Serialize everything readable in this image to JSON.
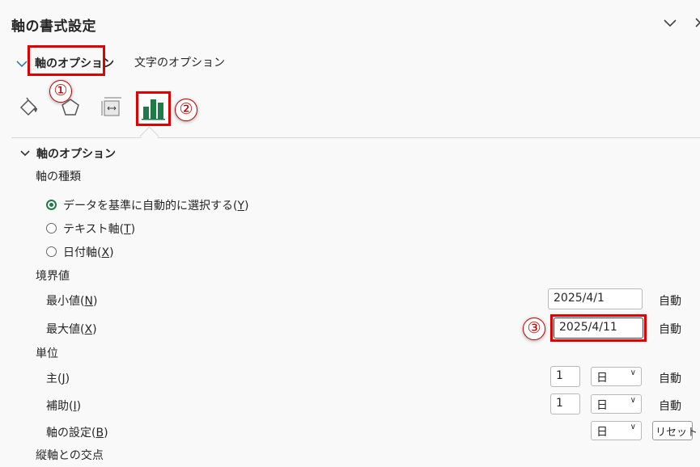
{
  "header": {
    "title": "軸の書式設定",
    "collapse_icon": "chevron-down-icon",
    "close_icon": "close-icon"
  },
  "tabs": {
    "axis_options": "軸のオプション",
    "text_options": "文字のオプション"
  },
  "icons": [
    "fill-line-icon",
    "effects-pentagon-icon",
    "size-properties-icon",
    "axis-options-bar-chart-icon"
  ],
  "badges": {
    "b1": "①",
    "b2": "②",
    "b3": "③"
  },
  "section": {
    "title": "軸のオプション",
    "axis_type": {
      "label": "軸の種類",
      "options": [
        {
          "text": "データを基準に自動的に選択する(",
          "key": "Y",
          "tail": ")",
          "selected": true
        },
        {
          "text": "テキスト軸(",
          "key": "T",
          "tail": ")",
          "selected": false
        },
        {
          "text": "日付軸(",
          "key": "X",
          "tail": ")",
          "selected": false
        }
      ]
    },
    "bounds": {
      "label": "境界値",
      "min": {
        "label": "最小値(",
        "key": "N",
        "tail": ")",
        "value": "2025/4/1",
        "auto": "自動"
      },
      "max": {
        "label": "最大値(",
        "key": "X",
        "tail": ")",
        "value": "2025/4/11",
        "auto": "自動"
      }
    },
    "units": {
      "label": "単位",
      "major": {
        "label": "主(",
        "key": "J",
        "tail": ")",
        "value": "1",
        "unit": "日",
        "auto": "自動"
      },
      "minor": {
        "label": "補助(",
        "key": "I",
        "tail": ")",
        "value": "1",
        "unit": "日",
        "auto": "自動"
      },
      "base": {
        "label": "軸の設定(",
        "key": "B",
        "tail": ")",
        "unit": "日",
        "reset": "リセット"
      }
    },
    "crosses_label": "縦軸との交点"
  },
  "colors": {
    "highlight": "#e00000",
    "accent": "#1e7a46"
  }
}
